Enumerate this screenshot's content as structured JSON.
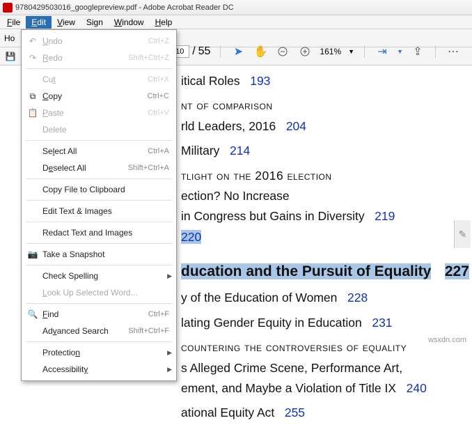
{
  "title": "9780429503016_googlepreview.pdf - Adobe Acrobat Reader DC",
  "menubar": [
    "File",
    "Edit",
    "View",
    "Sign",
    "Window",
    "Help"
  ],
  "tabbar_prefix": "Ho",
  "toolbar_left_icon": "💾",
  "page_toolbar": {
    "current": "10",
    "total": "55",
    "zoom": "161%"
  },
  "edit_menu": {
    "undo": {
      "label": "Undo",
      "shortcut": "Ctrl+Z",
      "icon": "↶"
    },
    "redo": {
      "label": "Redo",
      "shortcut": "Shift+Ctrl+Z",
      "icon": "↷"
    },
    "cut": {
      "label": "Cut",
      "shortcut": "Ctrl+X"
    },
    "copy": {
      "label": "Copy",
      "shortcut": "Ctrl+C",
      "icon": "⧉"
    },
    "paste": {
      "label": "Paste",
      "shortcut": "Ctrl+V",
      "icon": "📋"
    },
    "delete": {
      "label": "Delete"
    },
    "select_all": {
      "label": "Select All",
      "shortcut": "Ctrl+A"
    },
    "deselect_all": {
      "label": "Deselect All",
      "shortcut": "Shift+Ctrl+A"
    },
    "copy_file": {
      "label": "Copy File to Clipboard"
    },
    "edit_text": {
      "label": "Edit Text & Images"
    },
    "redact": {
      "label": "Redact Text and Images"
    },
    "snapshot": {
      "label": "Take a Snapshot",
      "icon": "📷"
    },
    "spelling": {
      "label": "Check Spelling"
    },
    "lookup": {
      "label": "Look Up Selected Word..."
    },
    "find": {
      "label": "Find",
      "shortcut": "Ctrl+F",
      "icon": "🔍"
    },
    "adv_search": {
      "label": "Advanced Search",
      "shortcut": "Shift+Ctrl+F"
    },
    "protection": {
      "label": "Protection"
    },
    "accessibility": {
      "label": "Accessibility"
    }
  },
  "doc": {
    "l1a": "itical Roles",
    "l1p": "193",
    "l2a": "nt of comparison",
    "l3a": "rld Leaders, 2016",
    "l3p": "204",
    "l4a": " Military",
    "l4p": "214",
    "l5a": "tlight on the 2016 election",
    "l6a": "ection? No Increase",
    "l7a": "in Congress but Gains in Diversity",
    "l7p": "219",
    "l8a": "220",
    "l9a": "ducation and the Pursuit of Equality",
    "l9p": "227",
    "l10a": "y of the Education of Women",
    "l10p": "228",
    "l11a": "lating Gender Equity in Education",
    "l11p": "231",
    "l12a": "countering the controversies of equality",
    "l13a": "s Alleged Crime Scene, Performance Art,",
    "l14a": "ement, and Maybe a Violation of Title IX",
    "l14p": "240",
    "l15a": "ational Equity Act",
    "l15p": "255"
  },
  "watermark": "wsxdn.com"
}
